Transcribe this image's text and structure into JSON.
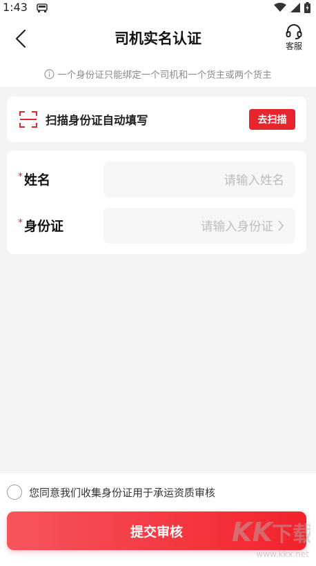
{
  "status_bar": {
    "time": "1:43"
  },
  "header": {
    "title": "司机实名认证",
    "service_label": "客服"
  },
  "notice": "一个身份证只能绑定一个司机和一个货主或两个货主",
  "scan": {
    "text": "扫描身份证自动填写",
    "button": "去扫描"
  },
  "form": {
    "required_mark": "*",
    "fields": [
      {
        "label": "姓名",
        "placeholder": "请输入姓名"
      },
      {
        "label": "身份证",
        "placeholder": "请输入身份证"
      }
    ]
  },
  "agreement": "您同意我们收集身份证用于承运资质审核",
  "submit_label": "提交审核",
  "watermark": {
    "logo": "kk下载",
    "url": "www.kkx.net"
  },
  "colors": {
    "accent": "#e8252e",
    "background": "#f4f4f4"
  }
}
